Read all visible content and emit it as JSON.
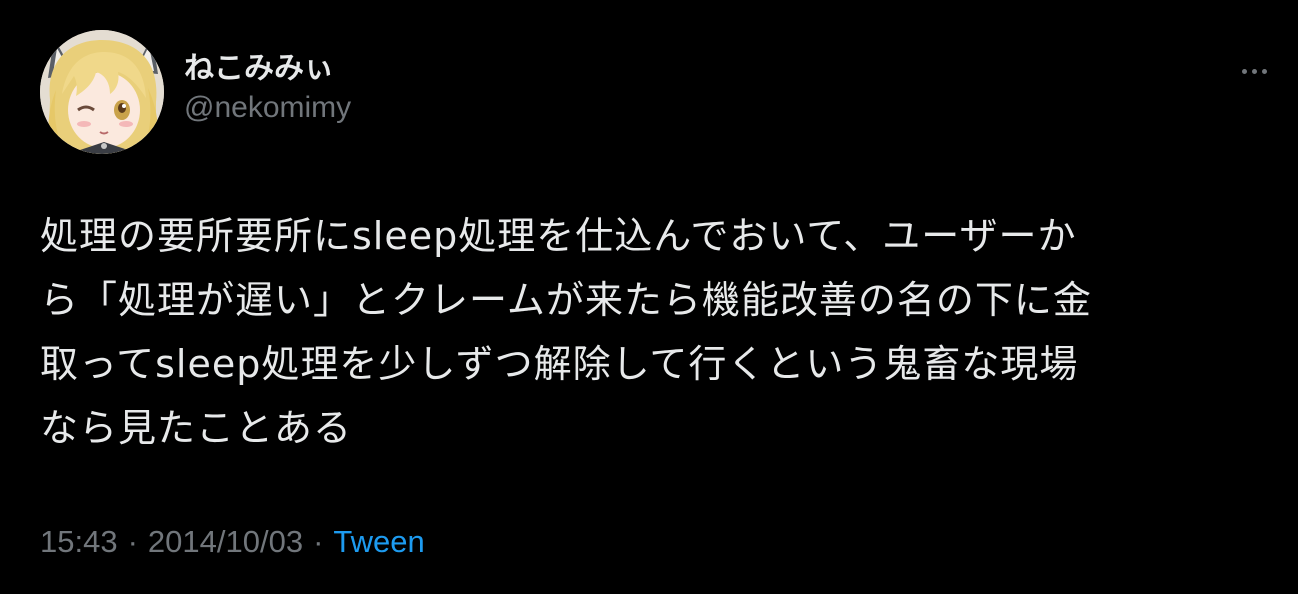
{
  "tweet": {
    "author": {
      "display_name": "ねこみみぃ",
      "handle": "@nekomimy",
      "avatar": "anime-girl-avatar"
    },
    "more_icon": "more-horizontal-icon",
    "text_lines": [
      "処理の要所要所にsleep処理を仕込んでおいて、ユーザーか",
      "ら「処理が遅い」とクレームが来たら機能改善の名の下に金",
      "取ってsleep処理を少しずつ解除して行くという鬼畜な現場",
      "なら見たことある"
    ],
    "time": "15:43",
    "separator": "·",
    "date": "2014/10/03",
    "source": "Tween"
  },
  "colors": {
    "background": "#000000",
    "primary_text": "#e7e9ea",
    "secondary_text": "#71767b",
    "link": "#1d9bf0"
  }
}
